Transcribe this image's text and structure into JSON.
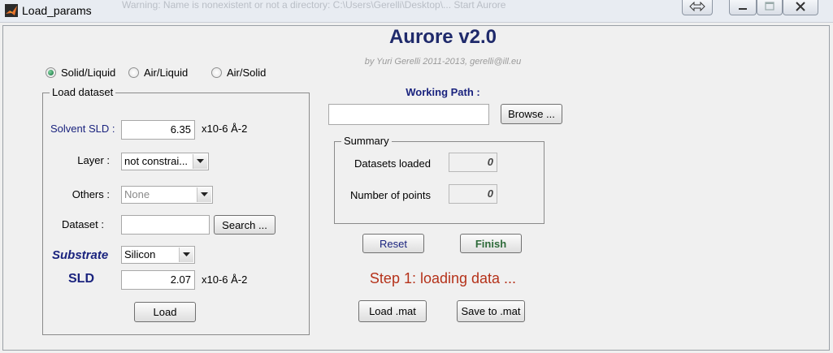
{
  "window": {
    "title": "Load_params",
    "background_text": "Warning: Name is nonexistent or not a directory: C:\\Users\\Gerelli\\Desktop\\... Start Aurore"
  },
  "header": {
    "app_title": "Aurore v2.0",
    "credit": "by Yuri Gerelli 2011-2013, gerelli@ill.eu"
  },
  "mode": {
    "options": [
      "Solid/Liquid",
      "Air/Liquid",
      "Air/Solid"
    ],
    "selected": "Solid/Liquid"
  },
  "load_dataset": {
    "legend": "Load dataset",
    "solvent_sld_label": "Solvent SLD :",
    "solvent_sld_value": "6.35",
    "unit": "x10-6 Å-2",
    "layer_label": "Layer :",
    "layer_value": "not constrai...",
    "others_label": "Others :",
    "others_value": "None",
    "dataset_label": "Dataset :",
    "dataset_value": "",
    "search_label": "Search ...",
    "substrate_label": "Substrate",
    "substrate_value": "Silicon",
    "sld_label": "SLD",
    "sld_value": "2.07",
    "load_label": "Load"
  },
  "working_path": {
    "label": "Working Path :",
    "value": "",
    "browse_label": "Browse ..."
  },
  "summary": {
    "legend": "Summary",
    "datasets_loaded_label": "Datasets loaded",
    "datasets_loaded_value": "0",
    "points_label": "Number of points",
    "points_value": "0"
  },
  "actions": {
    "reset_label": "Reset",
    "finish_label": "Finish",
    "load_mat_label": "Load .mat",
    "save_mat_label": "Save to .mat"
  },
  "status": {
    "step_text": "Step 1: loading data ..."
  },
  "colors": {
    "title_blue": "#1f2a6b",
    "label_blue": "#1a237e",
    "finish_green": "#2e6b3a",
    "status_red": "#b5321a"
  },
  "icons": {
    "app": "matlab-icon",
    "restore": "restore-arrows-icon",
    "minimize": "minimize-icon",
    "maximize": "maximize-icon",
    "close": "close-icon"
  }
}
